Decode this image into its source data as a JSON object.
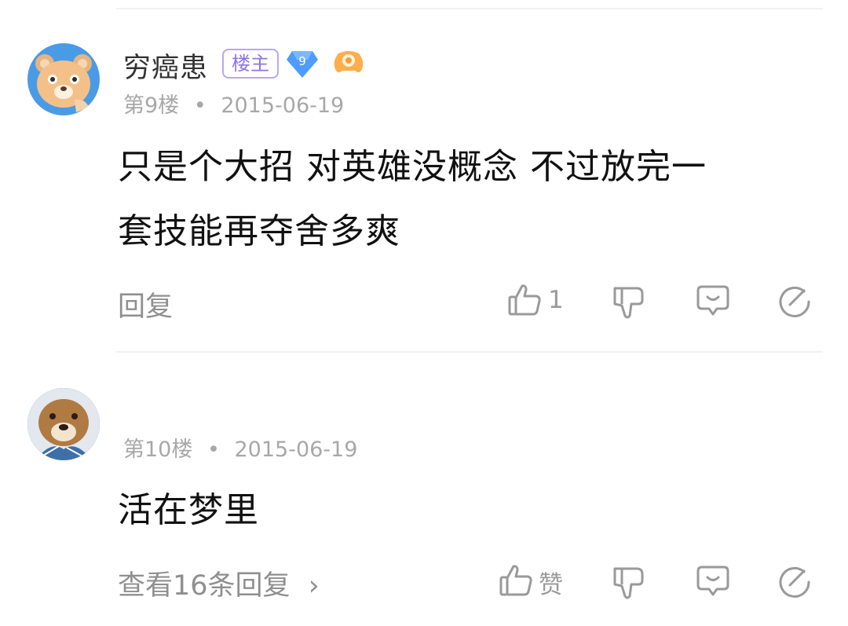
{
  "comments": [
    {
      "username": "穷癌患",
      "owner_badge": "楼主",
      "level": "9",
      "floor": "第9楼",
      "separator": "•",
      "date": "2015-06-19",
      "text_lines": [
        "只是个大招 对英雄没概念 不过放完一",
        "套技能再夺舍多爽"
      ],
      "reply_label": "回复",
      "like_count": "1"
    },
    {
      "floor": "第10楼",
      "separator": "•",
      "date": "2015-06-19",
      "text_lines": [
        "活在梦里"
      ],
      "reply_label": "查看16条回复",
      "reply_chevron": "›",
      "like_label": "赞"
    }
  ],
  "icons": {
    "like": "thumbs-up-icon",
    "dislike": "thumbs-down-icon",
    "comment": "comment-icon",
    "share": "share-icon",
    "level": "diamond-level-icon",
    "game": "gamepad-icon"
  },
  "colors": {
    "badge_purple": "#8d74e8",
    "diamond_blue": "#4f9cff",
    "gamepad_orange": "#ff9a3c",
    "icon_gray": "#9a9a9a"
  }
}
